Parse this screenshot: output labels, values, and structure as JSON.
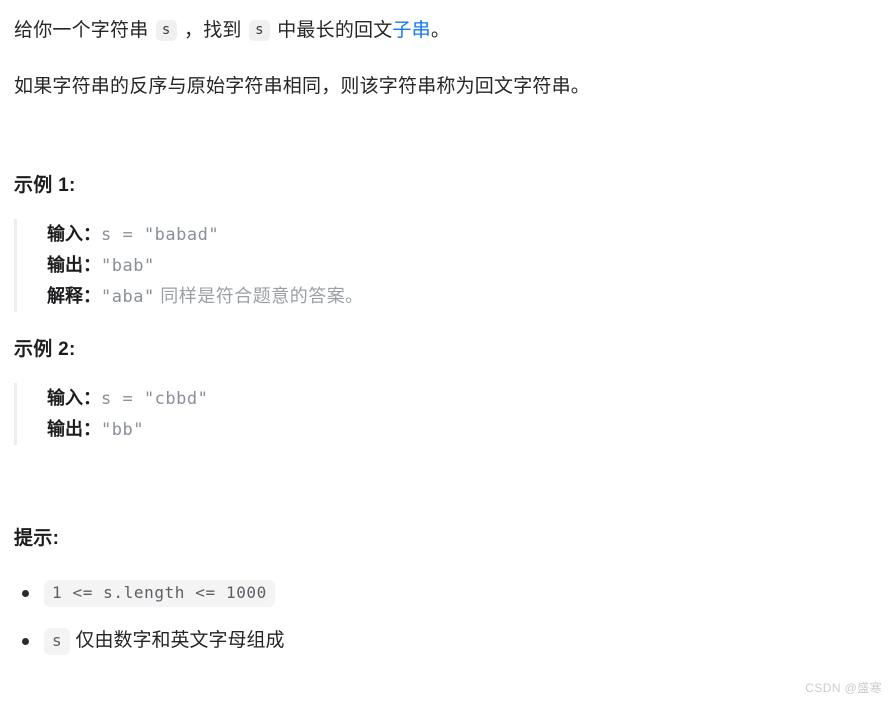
{
  "intro": {
    "line1_prefix": "给你一个字符串 ",
    "code_s_1": "s",
    "line1_mid": " ，找到 ",
    "code_s_2": "s",
    "line1_mid2": " 中最长的回文",
    "link_text": "子串",
    "line1_suffix": "。",
    "line2": "如果字符串的反序与原始字符串相同，则该字符串称为回文字符串。"
  },
  "examples": [
    {
      "heading": "示例 1:",
      "rows": [
        {
          "label": "输入：",
          "code": "s = \"babad\"",
          "note": ""
        },
        {
          "label": "输出：",
          "code": "\"bab\"",
          "note": ""
        },
        {
          "label": "解释：",
          "code": "\"aba\"",
          "note": " 同样是符合题意的答案。"
        }
      ]
    },
    {
      "heading": "示例 2:",
      "rows": [
        {
          "label": "输入：",
          "code": "s = \"cbbd\"",
          "note": ""
        },
        {
          "label": "输出：",
          "code": "\"bb\"",
          "note": ""
        }
      ]
    }
  ],
  "hints": {
    "heading": "提示:",
    "items": [
      {
        "code": "1 <= s.length <= 1000",
        "text": ""
      },
      {
        "code": "s",
        "text": " 仅由数字和英文字母组成"
      }
    ]
  },
  "watermark": "CSDN @盛寒",
  "colors": {
    "link": "#1479f0",
    "chip_bg": "#f0f0f0",
    "code_text": "#8a8f98",
    "quote_border": "#eceef0",
    "watermark": "#c9ccd1"
  }
}
